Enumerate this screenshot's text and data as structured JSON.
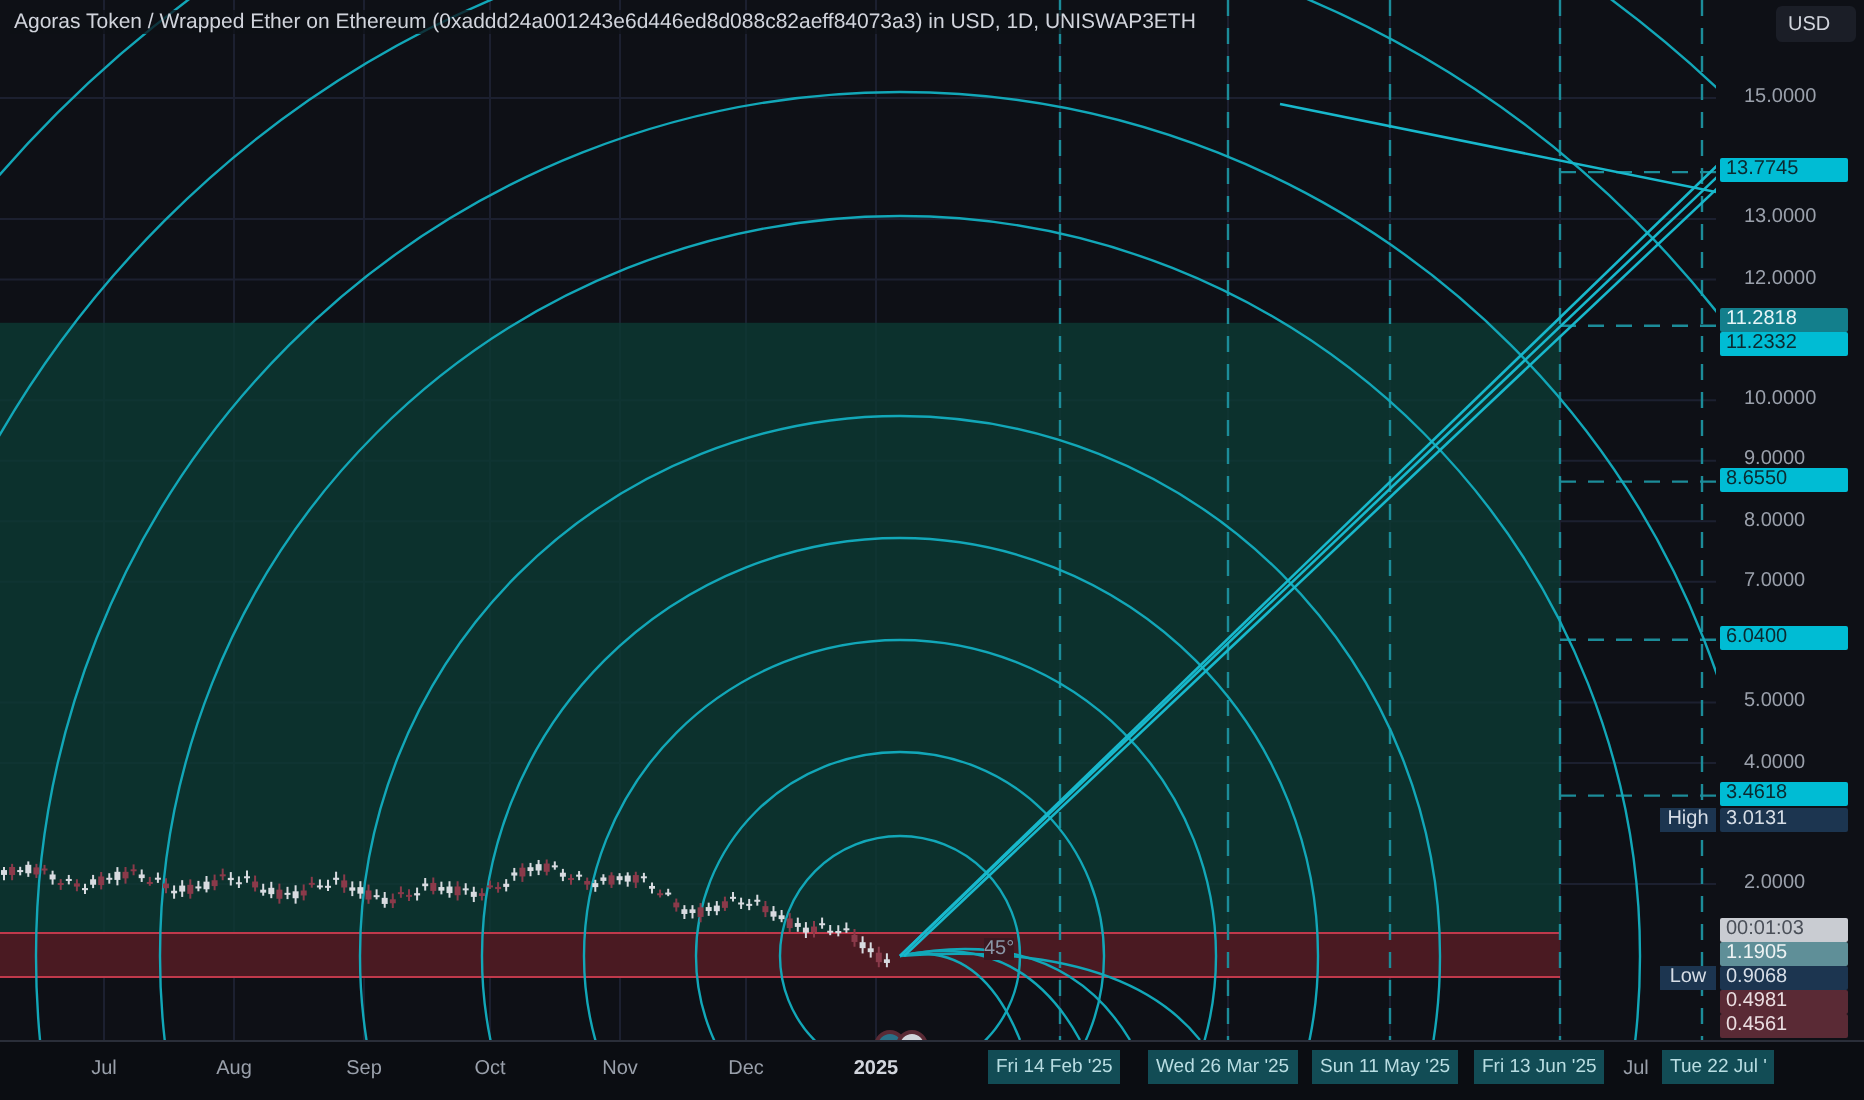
{
  "title": "Agoras Token / Wrapped Ether on Ethereum (0xaddd24a001243e6d446ed8d088c82aeff84073a3) in USD, 1D, UNISWAP3ETH",
  "currency_button": "USD",
  "price_ticks": [
    "15.0000",
    "13.0000",
    "12.0000",
    "10.0000",
    "9.0000",
    "8.0000",
    "7.0000",
    "5.0000",
    "4.0000",
    "2.0000"
  ],
  "price_tags": [
    {
      "kind": "drawing",
      "text": "13.7745"
    },
    {
      "kind": "drawing-dark",
      "text": "11.2818"
    },
    {
      "kind": "drawing",
      "text": "11.2332"
    },
    {
      "kind": "drawing",
      "text": "8.6550"
    },
    {
      "kind": "drawing",
      "text": "6.0400"
    },
    {
      "kind": "drawing",
      "text": "3.4618"
    },
    {
      "kind": "high",
      "label": "High",
      "text": "3.0131"
    },
    {
      "kind": "price",
      "text": "1.1905"
    },
    {
      "kind": "low",
      "label": "Low",
      "text": "0.9068"
    },
    {
      "kind": "bear",
      "text": "0.4981"
    },
    {
      "kind": "bear",
      "text": "0.4561"
    }
  ],
  "countdown": "00:01:03",
  "angle_label": "45°",
  "time_labels": [
    {
      "text": "Jul",
      "bold": false
    },
    {
      "text": "Aug",
      "bold": false
    },
    {
      "text": "Sep",
      "bold": false
    },
    {
      "text": "Oct",
      "bold": false
    },
    {
      "text": "Nov",
      "bold": false
    },
    {
      "text": "Dec",
      "bold": false
    },
    {
      "text": "2025",
      "bold": true
    },
    {
      "text": "Jul",
      "bold": false
    }
  ],
  "date_tags": [
    "Fri 14 Feb '25",
    "Wed 26 Mar '25",
    "Sun 11 May '25",
    "Fri 13 Jun '25",
    "Tue 22 Jul '"
  ]
}
